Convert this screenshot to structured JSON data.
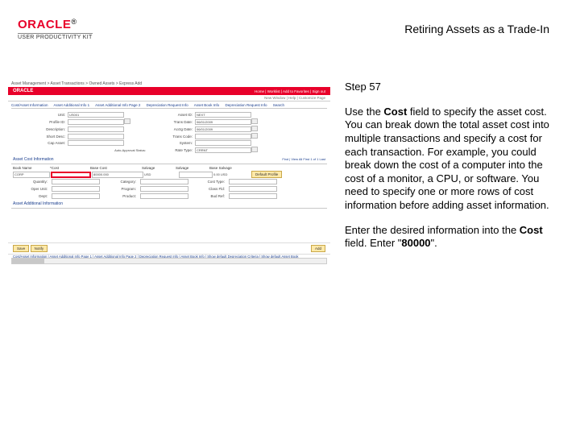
{
  "header": {
    "brand": "ORACLE",
    "reg": "®",
    "subtitle": "USER PRODUCTIVITY KIT",
    "doc_title": "Retiring Assets as a Trade-In"
  },
  "screenshot": {
    "crumb": "Asset Management > Asset Transactions > Owned Assets > Express Add",
    "app_brand": "ORACLE",
    "nav_right": "Home | Worklist | Add to Favorites | Sign out",
    "subnav": "New Window | Help | Customize Page",
    "tabs": [
      "Cost/Asset Information",
      "Asset Additional Info 1",
      "Asset Additional Info Page 2",
      "Depreciation Request Info",
      "Asset Book Info",
      "Depreciation Request Info",
      "Search"
    ],
    "form": {
      "unit_lbl": "Unit:",
      "unit_val": "US001",
      "assetid_lbl": "Asset ID:",
      "assetid_val": "NEXT",
      "profile_lbl": "Profile ID:",
      "profile_val": "",
      "transdate_lbl": "Trans Date:",
      "transdate_val": "06/01/2009",
      "desc_lbl": "Description:",
      "desc_val": "",
      "acctdate_lbl": "Acctg Date:",
      "acctdate_val": "06/01/2009",
      "short_lbl": "Short Desc:",
      "short_val": "",
      "transcode_lbl": "Trans Code:",
      "transcode_val": "",
      "capasset_lbl": "Cap Asset:",
      "capasset_val": "",
      "system_lbl": "System:",
      "system_val": "",
      "autoapp_lbl": "Auto-Approval Status:",
      "ratetype_lbl": "Rate Type:",
      "ratetype_val": "CRRNT"
    },
    "section_title": "Asset Cost Information",
    "find_lbl": "Find | View All   First 1 of 1 Last",
    "cost_headers": [
      "Book Name",
      "*Cost",
      "Base Cost",
      "Salvage",
      "Salvage",
      "Base Salvage",
      ""
    ],
    "cost_row": {
      "book": "CORP",
      "cost": "",
      "base_cost": "80000.000",
      "curr": "USD",
      "salvage": "",
      "salvage2": "0.00 USD",
      "btn": "Default Profile"
    },
    "small_rows": {
      "qty_lbl": "Quantity:",
      "qty_val": "",
      "cat_lbl": "Category:",
      "cat_val": "",
      "prof_lbl": "Cost Type:",
      "prof_val": "",
      "oper_lbl": "Oper Unit:",
      "oper_val": "",
      "fund_lbl": "Program:",
      "fund_val": "",
      "class_lbl": "Class Fld:",
      "class_val": "",
      "dept_lbl": "Dept:",
      "dept_val": "",
      "prod_lbl": "Product:",
      "prod_val": "",
      "bud_lbl": "Bud Ref:",
      "bud_val": ""
    },
    "addl_section": "Asset Additional Information",
    "save_btn": "Save",
    "notify_btn": "Notify",
    "add_btn": "Add",
    "footer_links": "Cost/Asset Information | Asset Additional Info Page 1 | Asset Additional Info Page 2 | Depreciation Request Info | Asset Book Info | Show default Depreciation Criteria | Show default Asset Book"
  },
  "instructions": {
    "step": "Step 57",
    "p1a": "Use the ",
    "p1b": "Cost",
    "p1c": " field to specify the asset cost. You can break down the total asset cost into multiple transactions and specify a cost for each transaction. For example, you could break down the cost of a computer into the cost of a monitor, a CPU, or software. You need to specify one or more rows of cost information before adding asset information.",
    "p2a": "Enter the desired information into the ",
    "p2b": "Cost",
    "p2c": " field. Enter \"",
    "p2d": "80000",
    "p2e": "\"."
  }
}
